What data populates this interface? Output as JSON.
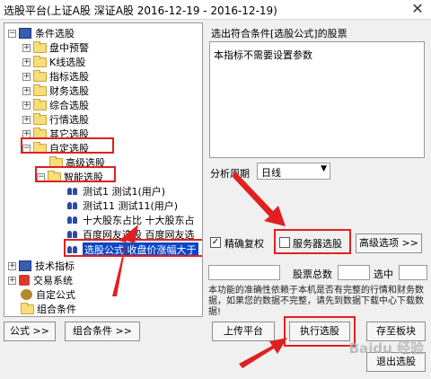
{
  "window": {
    "title": "选股平台(上证A股 深证A股   2016-12-19 - 2016-12-19)",
    "close_glyph": "✕"
  },
  "tree": {
    "root": "条件选股",
    "items": [
      "盘中预警",
      "K线选股",
      "指标选股",
      "财务选股",
      "综合选股",
      "行情选股",
      "其它选股",
      "自定选股"
    ],
    "custom_children": [
      "高级选股",
      "智能选股"
    ],
    "smart_children": [
      "测试1  测试1(用户)",
      "测试11  测试11(用户)",
      "十大股东占比  十大股东占",
      "百度网友选股  百度网友选"
    ],
    "selected": "选股公式  收盘价涨幅大于",
    "tech": "技术指标",
    "trade": "交易系统",
    "custom_formula": "自定公式",
    "combo": "组合条件"
  },
  "right": {
    "result_label": "选出符合条件[选股公式]的股票",
    "param_text": "本指标不需要设置参数",
    "period_label": "分析周期",
    "period_value": "日线",
    "precise_label": "精确复权",
    "precise_checked": "✓",
    "server_label": "服务器选股",
    "advanced_button": "高级选项 >>",
    "total_label": "股票总数",
    "selected_label": "选中",
    "note": "本功能的准确性依赖于本机是否有完整的行情和财务数据，如果您的数据不完整，请先到数据下载中心下载数据!"
  },
  "buttons": {
    "formula": "公式 >>",
    "combo": "组合条件 >>",
    "upload": "上传平台",
    "run": "执行选股",
    "save": "存至板块",
    "exit": "退出选股"
  },
  "watermark": "Baidu 经验",
  "colors": {
    "highlight": "#0a47c8",
    "annotation_red": "#e02020",
    "folder": "#f9dd7b"
  }
}
